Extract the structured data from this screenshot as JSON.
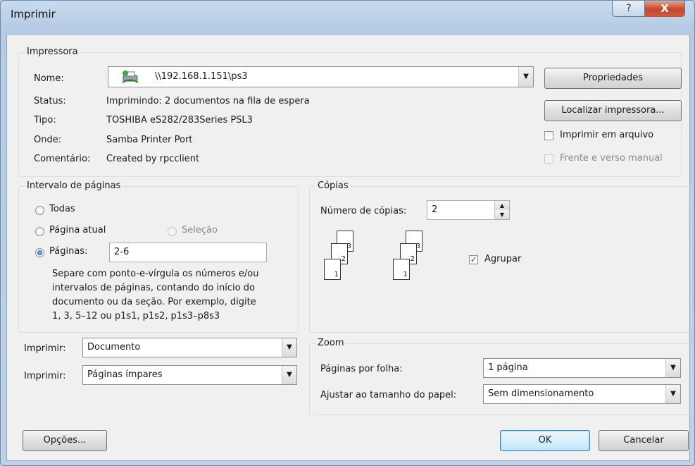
{
  "window": {
    "title": "Imprimir",
    "help_glyph": "?",
    "close_glyph": "X"
  },
  "printer": {
    "group_label": "Impressora",
    "name_label": "Nome:",
    "name_value": "\\\\192.168.1.151\\ps3",
    "status_label": "Status:",
    "status_value": "Imprimindo: 2 documentos na fila de espera",
    "type_label": "Tipo:",
    "type_value": "TOSHIBA eS282/283Series PSL3",
    "where_label": "Onde:",
    "where_value": "Samba Printer Port",
    "comment_label": "Comentário:",
    "comment_value": "Created by rpcclient",
    "properties_button": "Propriedades",
    "find_printer_button": "Localizar impressora...",
    "print_to_file_label": "Imprimir em arquivo",
    "print_to_file_checked": false,
    "duplex_label": "Frente e verso manual",
    "duplex_checked": false
  },
  "range": {
    "group_label": "Intervalo de páginas",
    "all_label": "Todas",
    "current_label": "Página atual",
    "selection_label": "Seleção",
    "pages_label": "Páginas:",
    "pages_value": "2-6",
    "selected": "pages",
    "hint_lines": [
      "Separe com ponto-e-vírgula os números e/ou",
      "intervalos de páginas, contando do início do",
      "documento ou da seção. Por exemplo, digite",
      "1, 3, 5–12 ou p1s1, p1s2, p1s3–p8s3"
    ]
  },
  "copies": {
    "group_label": "Cópias",
    "count_label": "Número de cópias:",
    "count_value": "2",
    "collate_label": "Agrupar",
    "collate_checked": true,
    "page_numbers": [
      "3",
      "2",
      "1"
    ]
  },
  "print_what": {
    "label": "Imprimir:",
    "value": "Documento"
  },
  "print_pages": {
    "label": "Imprimir:",
    "value": "Páginas ímpares"
  },
  "zoom": {
    "group_label": "Zoom",
    "pages_per_sheet_label": "Páginas por folha:",
    "pages_per_sheet_value": "1 página",
    "scale_label": "Ajustar ao tamanho do papel:",
    "scale_value": "Sem dimensionamento"
  },
  "buttons": {
    "options": "Opções...",
    "ok": "OK",
    "cancel": "Cancelar"
  },
  "icons": {
    "printer": "network-printer-icon",
    "dropdown": "chevron-down-icon",
    "spin_up": "spin-up-icon",
    "spin_down": "spin-down-icon"
  }
}
